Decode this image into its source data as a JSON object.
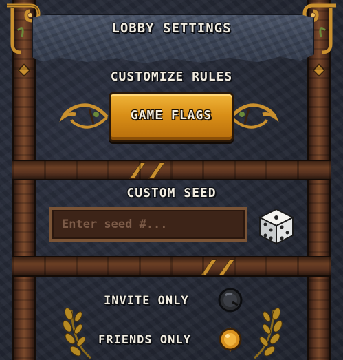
{
  "header": {
    "title": "LOBBY SETTINGS"
  },
  "rules": {
    "heading": "CUSTOMIZE RULES",
    "button_label": "GAME FLAGS"
  },
  "seed": {
    "heading": "CUSTOM SEED",
    "value": "",
    "placeholder": "Enter seed #..."
  },
  "options": {
    "invite_only": {
      "label": "INVITE ONLY",
      "enabled": false
    },
    "friends_only": {
      "label": "FRIENDS ONLY",
      "enabled": true
    }
  },
  "colors": {
    "gold": "#d98f17",
    "wood": "#5a3320",
    "stone": "#2b3040",
    "text": "#f1ece0"
  },
  "icons": {
    "dice": "dice-icon",
    "toggle_off": "dark-orb-icon",
    "toggle_on": "gold-orb-icon",
    "laurel": "laurel-icon"
  }
}
